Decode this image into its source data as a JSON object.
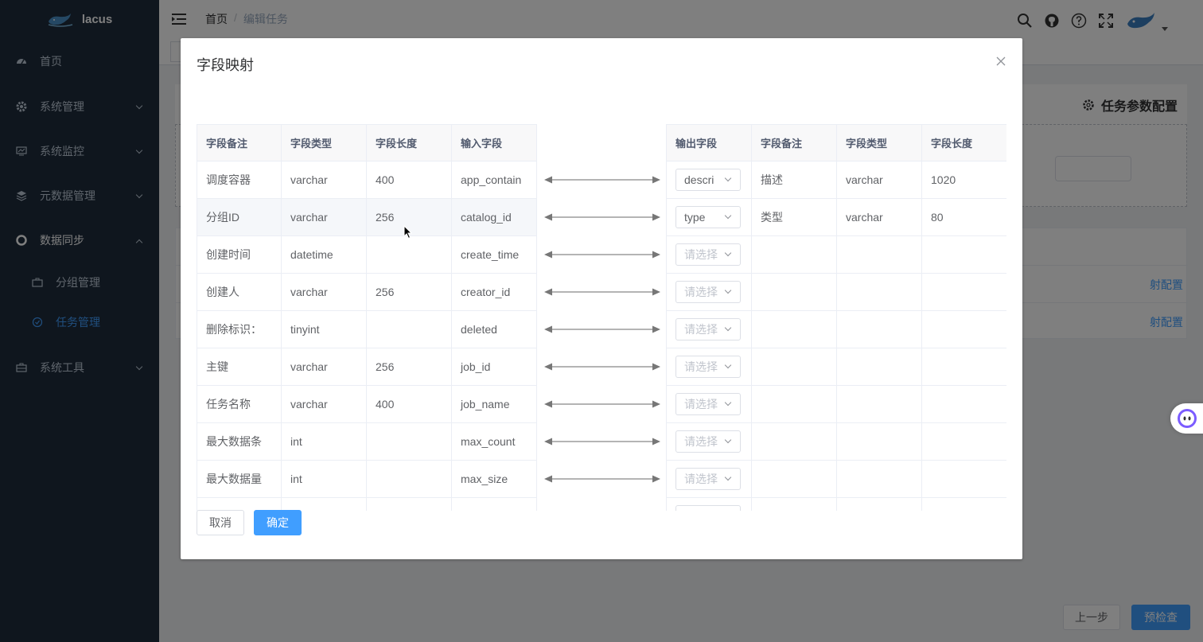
{
  "app": {
    "name": "lacus"
  },
  "sidebar": {
    "items": [
      {
        "label": "首页",
        "icon": "dashboard-icon"
      },
      {
        "label": "系统管理",
        "icon": "gear-icon"
      },
      {
        "label": "系统监控",
        "icon": "monitor-icon"
      },
      {
        "label": "元数据管理",
        "icon": "layers-icon"
      },
      {
        "label": "数据同步",
        "icon": "lifebuoy-icon",
        "expanded": true
      },
      {
        "label": "系统工具",
        "icon": "toolbox-icon"
      }
    ],
    "subitems": [
      {
        "label": "分组管理",
        "icon": "briefcase-icon"
      },
      {
        "label": "任务管理",
        "icon": "circle-check-icon",
        "active": true
      }
    ]
  },
  "navbar": {
    "breadcrumb_home": "首页",
    "breadcrumb_sep": "/",
    "breadcrumb_current": "编辑任务",
    "icons": [
      "search-icon",
      "github-icon",
      "help-icon",
      "fullscreen-icon"
    ]
  },
  "background": {
    "card_title": "任务参数配置",
    "link_label": "射配置",
    "prev_button": "上一步",
    "next_button": "预检查"
  },
  "dialog": {
    "title": "字段映射",
    "left_headers": [
      "字段备注",
      "字段类型",
      "字段长度",
      "输入字段"
    ],
    "right_headers": [
      "输出字段",
      "字段备注",
      "字段类型",
      "字段长度"
    ],
    "left_rows": [
      [
        "调度容器",
        "varchar",
        "400",
        "app_contain"
      ],
      [
        "分组ID",
        "varchar",
        "256",
        "catalog_id"
      ],
      [
        "创建时间",
        "datetime",
        "",
        "create_time"
      ],
      [
        "创建人",
        "varchar",
        "256",
        "creator_id"
      ],
      [
        "删除标识：",
        "tinyint",
        "",
        "deleted"
      ],
      [
        "主键",
        "varchar",
        "256",
        "job_id"
      ],
      [
        "任务名称",
        "varchar",
        "400",
        "job_name"
      ],
      [
        "最大数据条",
        "int",
        "",
        "max_count"
      ],
      [
        "最大数据量",
        "int",
        "",
        "max_size"
      ],
      [
        "",
        "",
        "",
        ""
      ]
    ],
    "right_rows": [
      {
        "output": "descri",
        "placeholder": false,
        "remark": "描述",
        "type": "varchar",
        "length": "1020"
      },
      {
        "output": "type",
        "placeholder": false,
        "remark": "类型",
        "type": "varchar",
        "length": "80"
      },
      {
        "output": "请选择",
        "placeholder": true,
        "remark": "",
        "type": "",
        "length": ""
      },
      {
        "output": "请选择",
        "placeholder": true,
        "remark": "",
        "type": "",
        "length": ""
      },
      {
        "output": "请选择",
        "placeholder": true,
        "remark": "",
        "type": "",
        "length": ""
      },
      {
        "output": "请选择",
        "placeholder": true,
        "remark": "",
        "type": "",
        "length": ""
      },
      {
        "output": "请选择",
        "placeholder": true,
        "remark": "",
        "type": "",
        "length": ""
      },
      {
        "output": "请选择",
        "placeholder": true,
        "remark": "",
        "type": "",
        "length": ""
      },
      {
        "output": "请选择",
        "placeholder": true,
        "remark": "",
        "type": "",
        "length": ""
      },
      {
        "output": "",
        "placeholder": true,
        "remark": "",
        "type": "",
        "length": ""
      }
    ],
    "cancel_label": "取消",
    "ok_label": "确定"
  },
  "colors": {
    "primary": "#409eff",
    "sidebar_bg": "#1f2d3d",
    "sidebar_text": "#bfcbd9"
  }
}
